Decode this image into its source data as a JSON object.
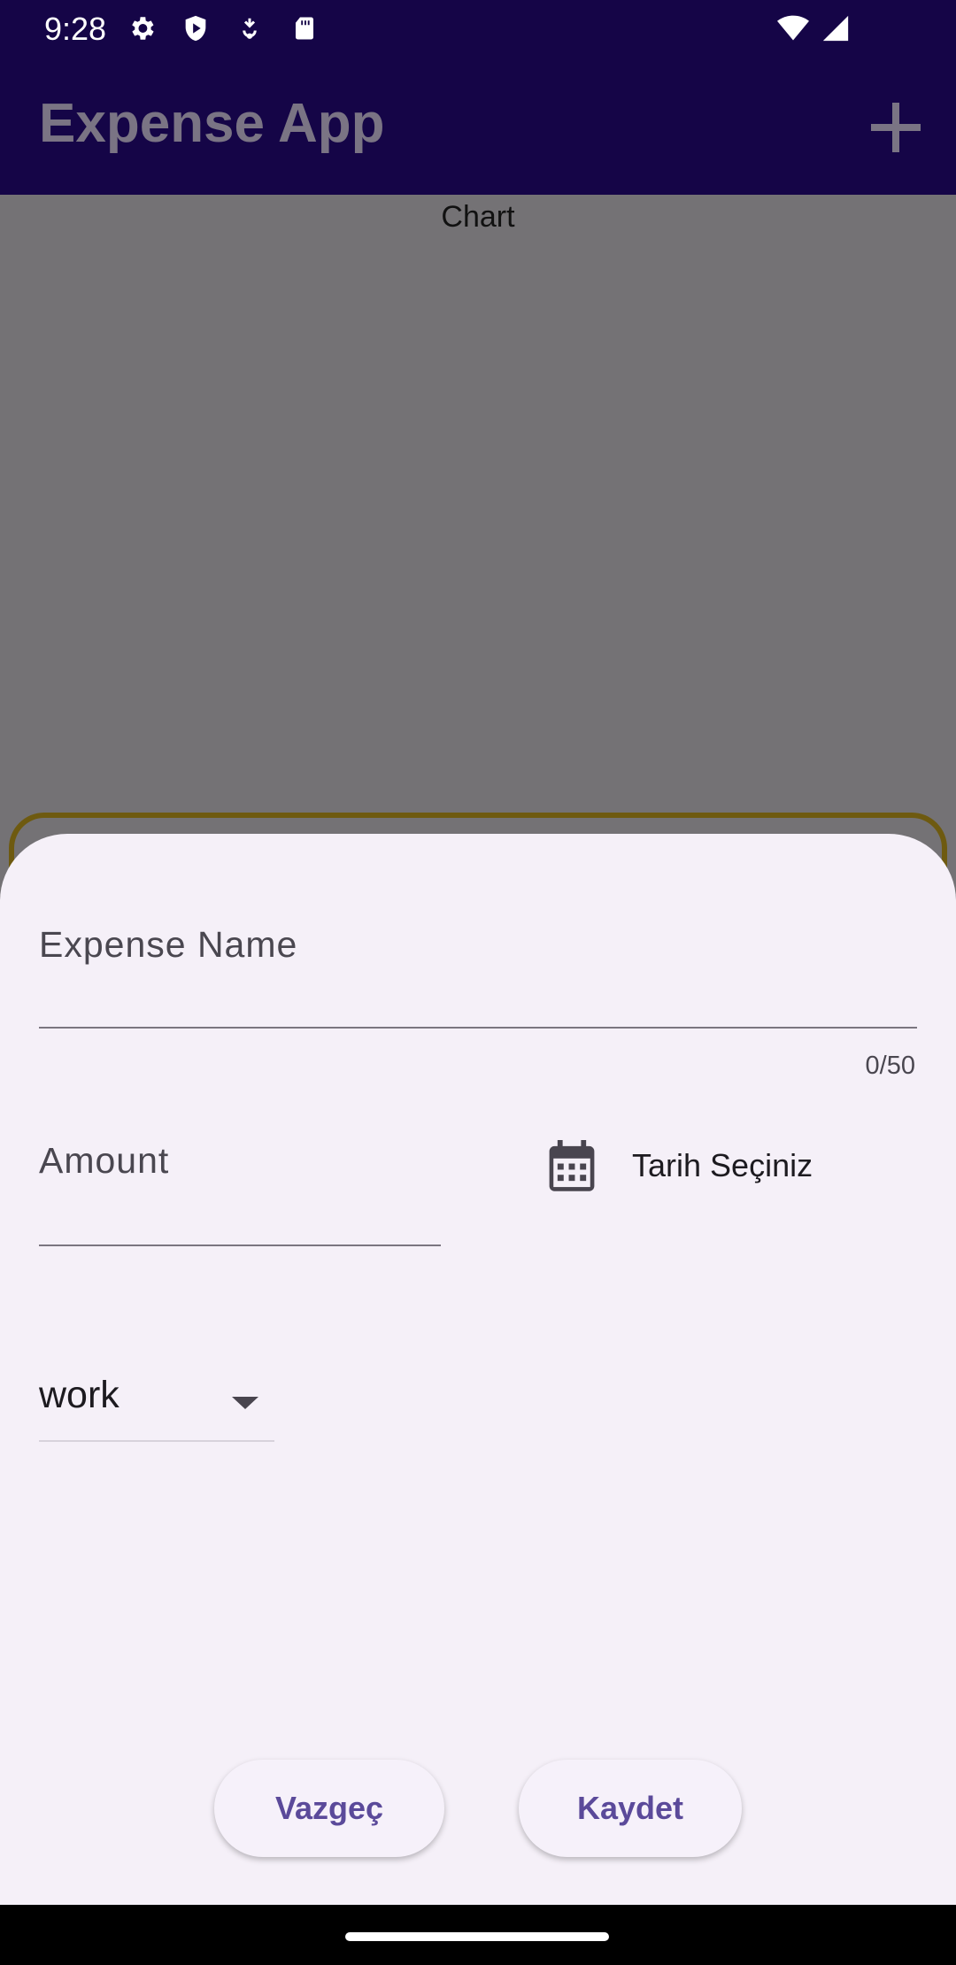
{
  "status_bar": {
    "time": "9:28",
    "icons": [
      "gear-icon",
      "shield-play-icon",
      "usb-icon",
      "sd-card-icon",
      "wifi-icon",
      "signal-icon"
    ]
  },
  "app_bar": {
    "title": "Expense App",
    "action_icon": "add-icon"
  },
  "content": {
    "chart_title": "Chart"
  },
  "form": {
    "expense_name_label": "Expense Name",
    "expense_name_value": "",
    "counter": "0/50",
    "amount_label": "Amount",
    "amount_value": "",
    "date_icon": "calendar-icon",
    "date_label": "Tarih Seçiniz",
    "category_value": "work",
    "cancel_label": "Vazgeç",
    "save_label": "Kaydet"
  },
  "colors": {
    "app_bar": "#150547",
    "scrim": "#747275",
    "sheet": "#f5f0f8",
    "button_text": "#5b4a9a"
  }
}
